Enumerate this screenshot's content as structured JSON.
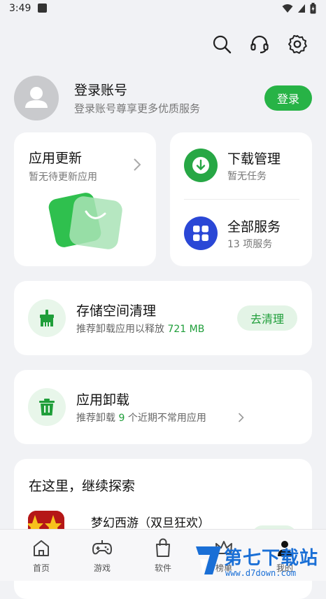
{
  "status_bar": {
    "time": "3:49"
  },
  "account": {
    "title": "登录账号",
    "subtitle": "登录账号尊享更多优质服务",
    "login_label": "登录"
  },
  "update_card": {
    "title": "应用更新",
    "subtitle": "暂无待更新应用"
  },
  "download_card": {
    "title": "下载管理",
    "subtitle": "暂无任务"
  },
  "services_card": {
    "title": "全部服务",
    "subtitle": "13 项服务"
  },
  "storage_card": {
    "title": "存储空间清理",
    "subtitle_prefix": "推荐卸载应用以释放 ",
    "subtitle_value": "721 MB",
    "button_label": "去清理"
  },
  "uninstall_card": {
    "title": "应用卸载",
    "subtitle_prefix": "推荐卸载 ",
    "subtitle_count": "9",
    "subtitle_suffix": " 个近期不常用应用"
  },
  "explore": {
    "title": "在这里，继续探索",
    "items": [
      {
        "name": "梦幻西游（双旦狂欢）"
      }
    ]
  },
  "bottom_nav": {
    "items": [
      {
        "label": "首页",
        "icon": "home-icon"
      },
      {
        "label": "游戏",
        "icon": "gamepad-icon"
      },
      {
        "label": "软件",
        "icon": "shopping-bag-icon"
      },
      {
        "label": "榜单",
        "icon": "crown-icon"
      },
      {
        "label": "我的",
        "icon": "person-icon"
      }
    ]
  },
  "watermark": {
    "title": "第七下载站",
    "url": "www.d7down.com"
  },
  "colors": {
    "accent_green": "#27b346",
    "blue": "#2a47d6",
    "background": "#f1f2f5"
  }
}
